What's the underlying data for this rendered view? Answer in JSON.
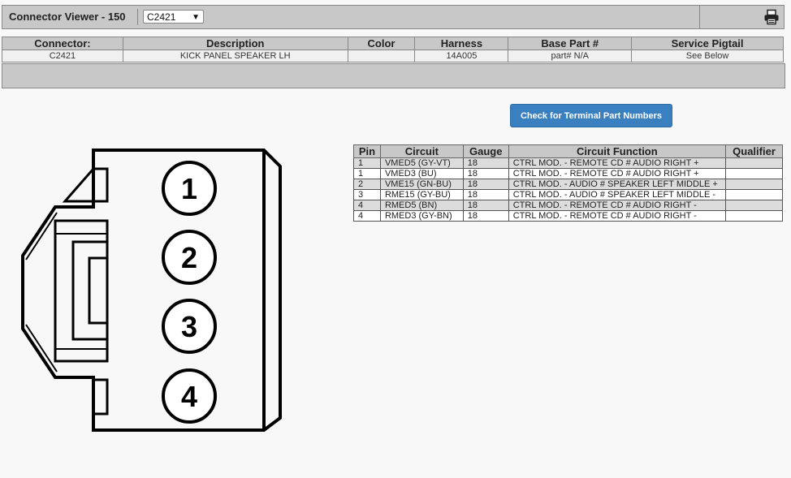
{
  "header": {
    "title": "Connector Viewer - 150",
    "connector_select": "C2421",
    "print_icon": "printer-icon"
  },
  "connector_table": {
    "headers": [
      "Connector:",
      "Description",
      "Color",
      "Harness",
      "Base Part #",
      "Service Pigtail"
    ],
    "row": [
      "C2421",
      "KICK PANEL SPEAKER LH",
      "",
      "14A005",
      "part# N/A",
      "See Below"
    ]
  },
  "check_button": "Check for Terminal Part Numbers",
  "diagram": {
    "pin_labels": [
      "1",
      "2",
      "3",
      "4"
    ]
  },
  "pin_table": {
    "headers": [
      "Pin",
      "Circuit",
      "Gauge",
      "Circuit Function",
      "Qualifier"
    ],
    "rows": [
      [
        "1",
        "VMED5 (GY-VT)",
        "18",
        "CTRL MOD. - REMOTE CD # AUDIO RIGHT +",
        ""
      ],
      [
        "1",
        "VMED3 (BU)",
        "18",
        "CTRL MOD. - REMOTE CD # AUDIO RIGHT +",
        ""
      ],
      [
        "2",
        "VME15 (GN-BU)",
        "18",
        "CTRL MOD. - AUDIO # SPEAKER LEFT MIDDLE +",
        ""
      ],
      [
        "3",
        "RME15 (GY-BU)",
        "18",
        "CTRL MOD. - AUDIO # SPEAKER LEFT MIDDLE -",
        ""
      ],
      [
        "4",
        "RMED5 (BN)",
        "18",
        "CTRL MOD. - REMOTE CD # AUDIO RIGHT -",
        ""
      ],
      [
        "4",
        "RMED3 (GY-BN)",
        "18",
        "CTRL MOD. - REMOTE CD # AUDIO RIGHT -",
        ""
      ]
    ]
  }
}
